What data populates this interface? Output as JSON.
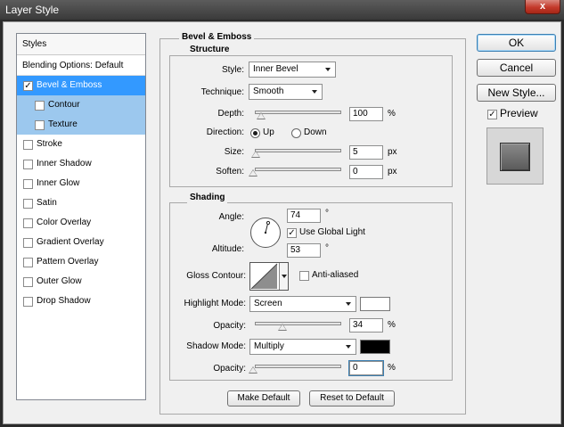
{
  "window": {
    "title": "Layer Style",
    "close_glyph": "x"
  },
  "styles_panel": {
    "header": "Styles",
    "blending": "Blending Options: Default",
    "items": [
      {
        "label": "Bevel & Emboss",
        "checked": true
      },
      {
        "label": "Contour",
        "checked": false
      },
      {
        "label": "Texture",
        "checked": false
      },
      {
        "label": "Stroke",
        "checked": false
      },
      {
        "label": "Inner Shadow",
        "checked": false
      },
      {
        "label": "Inner Glow",
        "checked": false
      },
      {
        "label": "Satin",
        "checked": false
      },
      {
        "label": "Color Overlay",
        "checked": false
      },
      {
        "label": "Gradient Overlay",
        "checked": false
      },
      {
        "label": "Pattern Overlay",
        "checked": false
      },
      {
        "label": "Outer Glow",
        "checked": false
      },
      {
        "label": "Drop Shadow",
        "checked": false
      }
    ]
  },
  "bevel": {
    "title": "Bevel & Emboss",
    "structure": {
      "title": "Structure",
      "style_label": "Style:",
      "style_value": "Inner Bevel",
      "technique_label": "Technique:",
      "technique_value": "Smooth",
      "depth_label": "Depth:",
      "depth_value": "100",
      "depth_unit": "%",
      "direction_label": "Direction:",
      "direction_up": "Up",
      "direction_down": "Down",
      "size_label": "Size:",
      "size_value": "5",
      "size_unit": "px",
      "soften_label": "Soften:",
      "soften_value": "0",
      "soften_unit": "px"
    },
    "shading": {
      "title": "Shading",
      "angle_label": "Angle:",
      "angle_value": "74",
      "angle_unit": "°",
      "global_light": "Use Global Light",
      "altitude_label": "Altitude:",
      "altitude_value": "53",
      "altitude_unit": "°",
      "gloss_label": "Gloss Contour:",
      "antialiased": "Anti-aliased",
      "highlight_label": "Highlight Mode:",
      "highlight_value": "Screen",
      "highlight_color": "#ffffff",
      "highlight_opacity_label": "Opacity:",
      "highlight_opacity_value": "34",
      "highlight_opacity_unit": "%",
      "shadow_label": "Shadow Mode:",
      "shadow_value": "Multiply",
      "shadow_color": "#000000",
      "shadow_opacity_label": "Opacity:",
      "shadow_opacity_value": "0",
      "shadow_opacity_unit": "%"
    },
    "make_default": "Make Default",
    "reset_default": "Reset to Default"
  },
  "actions": {
    "ok": "OK",
    "cancel": "Cancel",
    "new_style": "New Style...",
    "preview": "Preview"
  },
  "colors": {
    "selection": "#3399ff",
    "sub_selection": "#9cc8ee",
    "dialog_bg": "#f0f0f0"
  }
}
